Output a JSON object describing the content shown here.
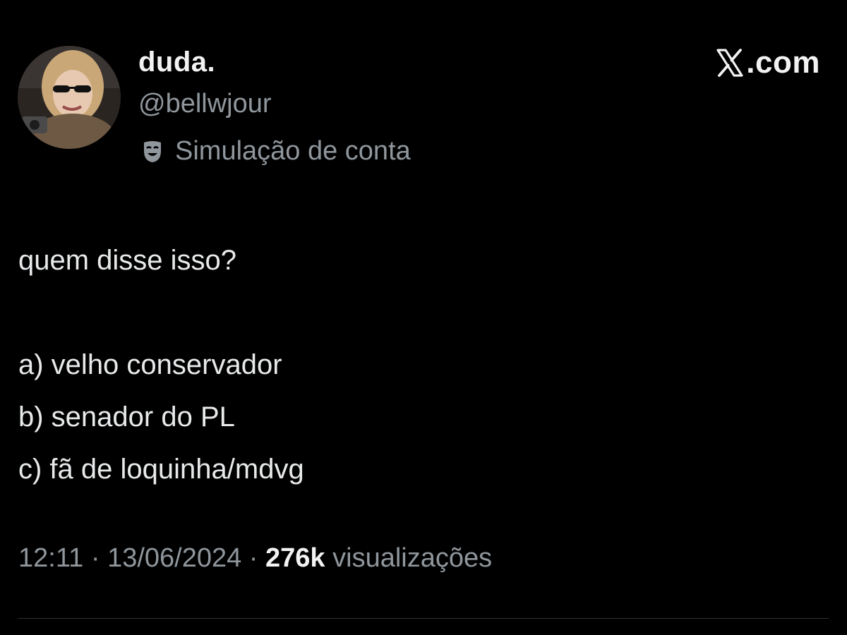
{
  "brand": {
    "logo_icon": "x-logo-icon",
    "label": ".com"
  },
  "author": {
    "avatar_icon": "avatar-photo",
    "display_name": "duda.",
    "handle": "@bellwjour",
    "parody_icon": "parody-mask-icon",
    "parody_label": "Simulação de conta"
  },
  "tweet": {
    "lines": [
      "quem disse isso?",
      "",
      "a) velho conservador",
      "b) senador do PL",
      "c) fã de loquinha/mdvg"
    ],
    "time": "12:11",
    "separator": " · ",
    "date": "13/06/2024",
    "views_count": "276k",
    "views_label": " visualizações"
  },
  "colors": {
    "background": "#000000",
    "primary_text": "#e7e9ea",
    "secondary_text": "#8f969c",
    "divider": "#2f3336"
  }
}
